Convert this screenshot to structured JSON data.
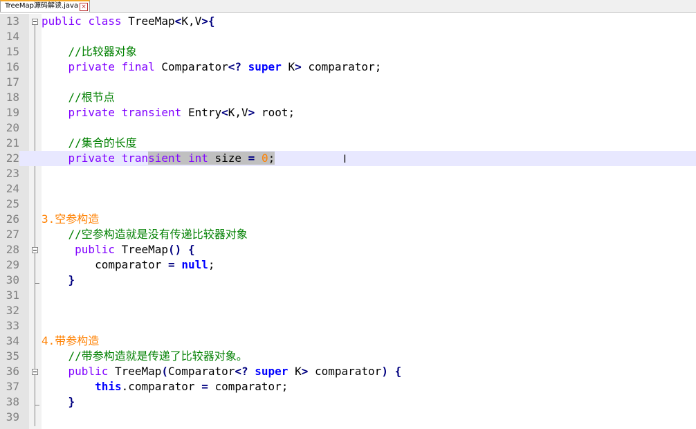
{
  "tab": {
    "title": "TreeMap源码解读.java",
    "close_glyph": "×"
  },
  "lines": [
    {
      "n": "13"
    },
    {
      "n": "14"
    },
    {
      "n": "15"
    },
    {
      "n": "16"
    },
    {
      "n": "17"
    },
    {
      "n": "18"
    },
    {
      "n": "19"
    },
    {
      "n": "20"
    },
    {
      "n": "21"
    },
    {
      "n": "22"
    },
    {
      "n": "23"
    },
    {
      "n": "24"
    },
    {
      "n": "25"
    },
    {
      "n": "26"
    },
    {
      "n": "27"
    },
    {
      "n": "28"
    },
    {
      "n": "29"
    },
    {
      "n": "30"
    },
    {
      "n": "31"
    },
    {
      "n": "32"
    },
    {
      "n": "33"
    },
    {
      "n": "34"
    },
    {
      "n": "35"
    },
    {
      "n": "36"
    },
    {
      "n": "37"
    },
    {
      "n": "38"
    },
    {
      "n": "39"
    }
  ],
  "code": {
    "l13": {
      "a": "public",
      "b": " ",
      "c": "class",
      "d": " TreeMap",
      "e": "<",
      "f": "K,V",
      "g": ">{"
    },
    "l15": {
      "comment": "    //比较器对象"
    },
    "l16": {
      "a": "    private",
      "b": " ",
      "c": "final",
      "d": " Comparator",
      "e": "<?",
      "f": " ",
      "g": "super",
      "h": " K",
      "i": ">",
      "j": " comparator;"
    },
    "l18": {
      "comment": "    //根节点"
    },
    "l19": {
      "a": "    private",
      "b": " ",
      "c": "transient",
      "d": " Entry",
      "e": "<",
      "f": "K,V",
      "g": ">",
      "h": " root;"
    },
    "l21": {
      "comment": "    //集合的长度"
    },
    "l22": {
      "a": "    private",
      "b": " ",
      "c": "tran",
      "d": "sient",
      "e": " ",
      "f": "int",
      "g": " size ",
      "h": "=",
      "i": " ",
      "j": "0",
      "k": ";"
    },
    "l26": {
      "heading": "3.空参构造"
    },
    "l27": {
      "comment": "    //空参构造就是没有传递比较器对象"
    },
    "l28": {
      "a": "     public",
      "b": " TreeMap",
      "c": "()",
      "d": " ",
      "e": "{"
    },
    "l29": {
      "a": "        comparator ",
      "b": "=",
      "c": " ",
      "d": "null",
      "e": ";"
    },
    "l30": {
      "a": "    ",
      "b": "}"
    },
    "l34": {
      "heading": "4.带参构造"
    },
    "l35": {
      "comment": "    //带参构造就是传递了比较器对象。"
    },
    "l36": {
      "a": "    public",
      "b": " TreeMap",
      "c": "(",
      "d": "Comparator",
      "e": "<?",
      "f": " ",
      "g": "super",
      "h": " K",
      "i": ">",
      "j": " comparator",
      "k": ")",
      "l": " ",
      "m": "{"
    },
    "l37": {
      "a": "        ",
      "b": "this",
      "c": ".comparator ",
      "d": "=",
      "e": " comparator;"
    },
    "l38": {
      "a": "    ",
      "b": "}"
    }
  },
  "icons": {
    "text_cursor": "I-beam-cursor-icon",
    "fold": "fold-minus-icon"
  },
  "colors": {
    "keyword": "#8000ff",
    "keyword_bold": "#0000ff",
    "comment": "#008000",
    "number": "#ff8000",
    "current_line": "#e8e8ff"
  }
}
